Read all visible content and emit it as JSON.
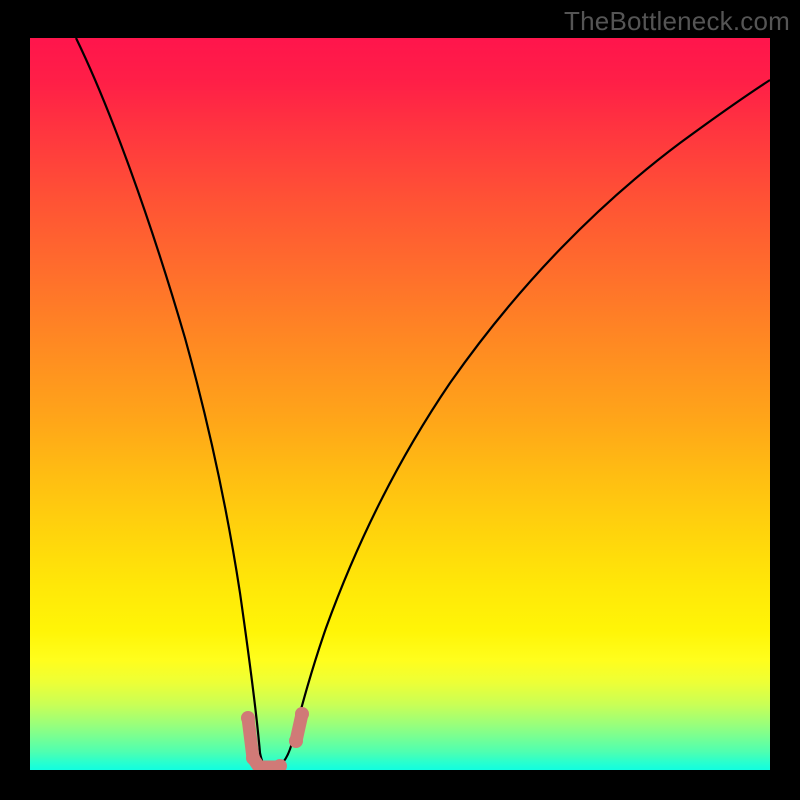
{
  "watermark": "TheBottleneck.com",
  "chart_data": {
    "type": "line",
    "title": "",
    "xlabel": "",
    "ylabel": "",
    "x_range": [
      0,
      1
    ],
    "y_range": [
      0,
      1
    ],
    "series": [
      {
        "name": "bottleneck-curve",
        "x": [
          0.0,
          0.05,
          0.1,
          0.15,
          0.2,
          0.24,
          0.27,
          0.295,
          0.31,
          0.33,
          0.36,
          0.4,
          0.45,
          0.52,
          0.6,
          0.7,
          0.8,
          0.9,
          1.0
        ],
        "y": [
          1.0,
          0.87,
          0.74,
          0.6,
          0.44,
          0.29,
          0.16,
          0.06,
          0.01,
          0.01,
          0.055,
          0.15,
          0.26,
          0.39,
          0.5,
          0.61,
          0.695,
          0.76,
          0.81
        ]
      }
    ],
    "markers": [
      {
        "name": "left-marker-top",
        "x": 0.296,
        "y": 0.066
      },
      {
        "name": "left-marker-bottom",
        "x": 0.302,
        "y": 0.015
      },
      {
        "name": "valley-marker",
        "x": 0.335,
        "y": 0.005
      },
      {
        "name": "right-marker-bottom",
        "x": 0.362,
        "y": 0.028
      },
      {
        "name": "right-marker-top",
        "x": 0.37,
        "y": 0.07
      }
    ],
    "gradient_stops": [
      {
        "pos": 0.0,
        "color": "#ff154c"
      },
      {
        "pos": 0.85,
        "color": "#fffe1d"
      },
      {
        "pos": 1.0,
        "color": "#11fee0"
      }
    ]
  }
}
